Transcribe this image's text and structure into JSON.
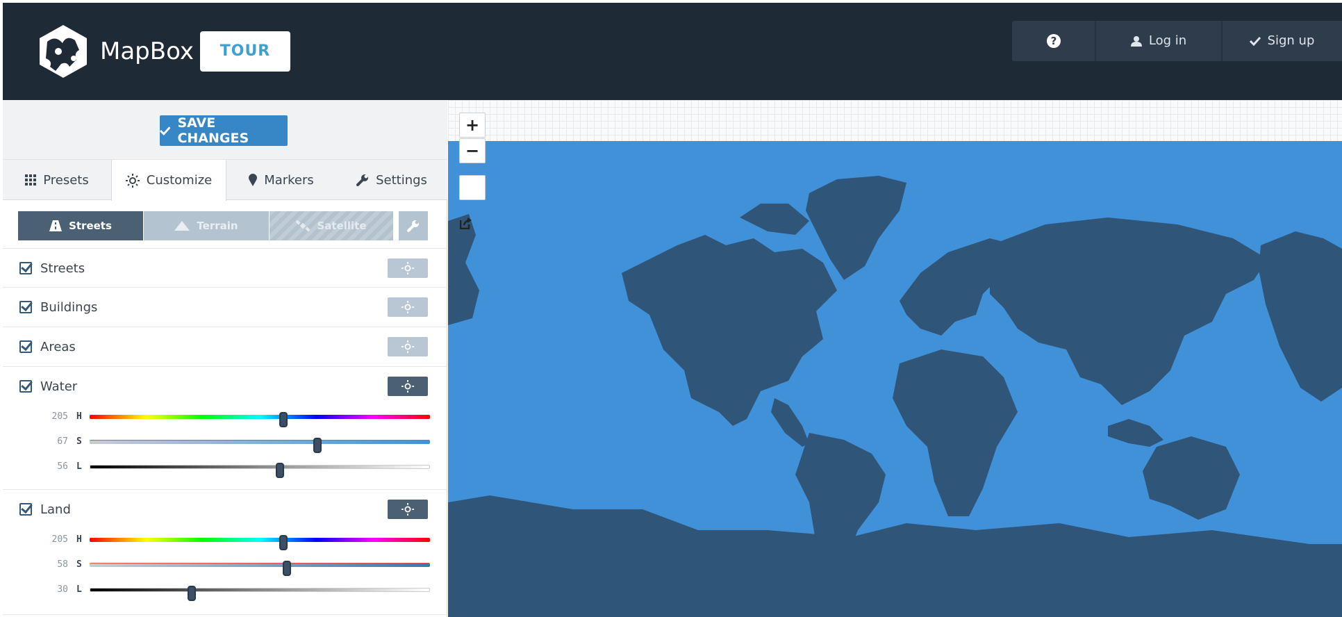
{
  "header": {
    "brand": "MapBox",
    "tour_label": "TOUR",
    "help_icon": "question-circle-icon",
    "login_label": "Log in",
    "signup_label": "Sign up"
  },
  "sidebar": {
    "save_label": "SAVE CHANGES",
    "tabs": [
      {
        "label": "Presets",
        "icon": "grid-icon"
      },
      {
        "label": "Customize",
        "icon": "sun-icon",
        "active": true
      },
      {
        "label": "Markers",
        "icon": "marker-icon"
      },
      {
        "label": "Settings",
        "icon": "wrench-icon"
      }
    ],
    "modes": [
      {
        "label": "Streets",
        "active": true
      },
      {
        "label": "Terrain"
      },
      {
        "label": "Satellite"
      }
    ],
    "layers": [
      {
        "label": "Streets",
        "checked": true
      },
      {
        "label": "Buildings",
        "checked": true
      },
      {
        "label": "Areas",
        "checked": true
      },
      {
        "label": "Water",
        "checked": true,
        "h": "205",
        "s": "67",
        "l": "56",
        "h_pos": 0.57,
        "s_pos": 0.67,
        "l_pos": 0.56
      },
      {
        "label": "Land",
        "checked": true,
        "h": "205",
        "s": "58",
        "l": "30",
        "h_pos": 0.57,
        "s_pos": 0.58,
        "l_pos": 0.3
      }
    ],
    "slider_letters": {
      "h": "H",
      "s": "S",
      "l": "L"
    }
  },
  "map": {
    "zoom_in": "+",
    "zoom_out": "−",
    "water_color": "#4191d8",
    "land_color": "#2f5579"
  }
}
